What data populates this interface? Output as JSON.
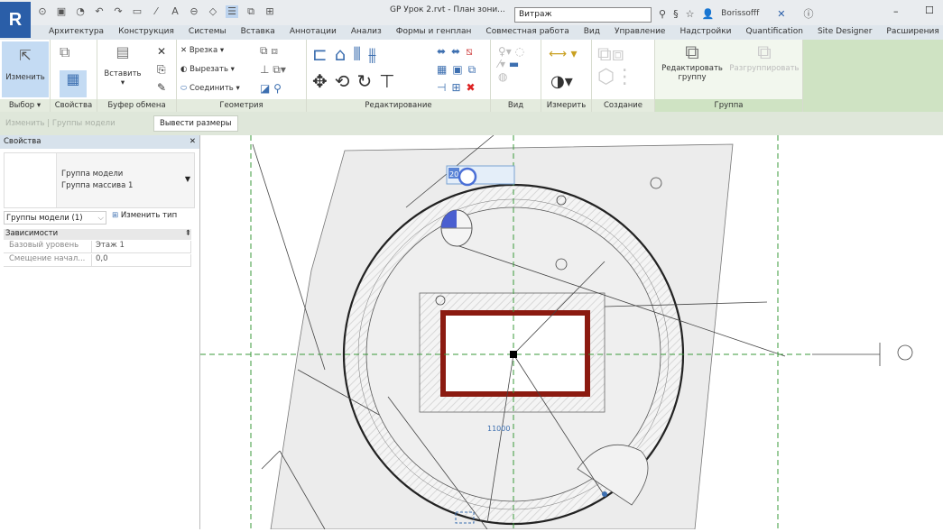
{
  "app": {
    "logo": "R",
    "document_title": "GP Урок 2.rvt - План зони...",
    "search_value": "Витраж",
    "user": "Borissofff"
  },
  "tabs": [
    "Архитектура",
    "Конструкция",
    "Системы",
    "Вставка",
    "Аннотации",
    "Анализ",
    "Формы и генплан",
    "Совместная работа",
    "Вид",
    "Управление",
    "Надстройки",
    "Quantification",
    "Site Designer",
    "Расширения"
  ],
  "ribbon": {
    "modify": "Изменить",
    "paste": "Вставить",
    "cope": "Врезка",
    "cut": "Вырезать",
    "join": "Соединить",
    "edit_group": "Редактировать группу",
    "ungroup": "Разгруппировать",
    "panels": [
      "Выбор",
      "Свойства",
      "Буфер обмена",
      "Геометрия",
      "Редактирование",
      "Вид",
      "Измерить",
      "Создание",
      "Группа"
    ]
  },
  "context": {
    "label": "Изменить | Группы модели",
    "button": "Вывести размеры"
  },
  "properties": {
    "title": "Свойства",
    "type_line1": "Группа модели",
    "type_line2": "Группа массива 1",
    "filter": "Группы модели (1)",
    "edit_type": "Изменить тип",
    "group": "Зависимости",
    "rows": [
      {
        "key": "Базовый уровень",
        "value": "Этаж 1"
      },
      {
        "key": "Смещение начал...",
        "value": "0,0"
      }
    ]
  },
  "canvas": {
    "temp_input": "20",
    "dimension": "11000",
    "accent": "#8b1a10",
    "grid_color": "#3a9a3a"
  }
}
